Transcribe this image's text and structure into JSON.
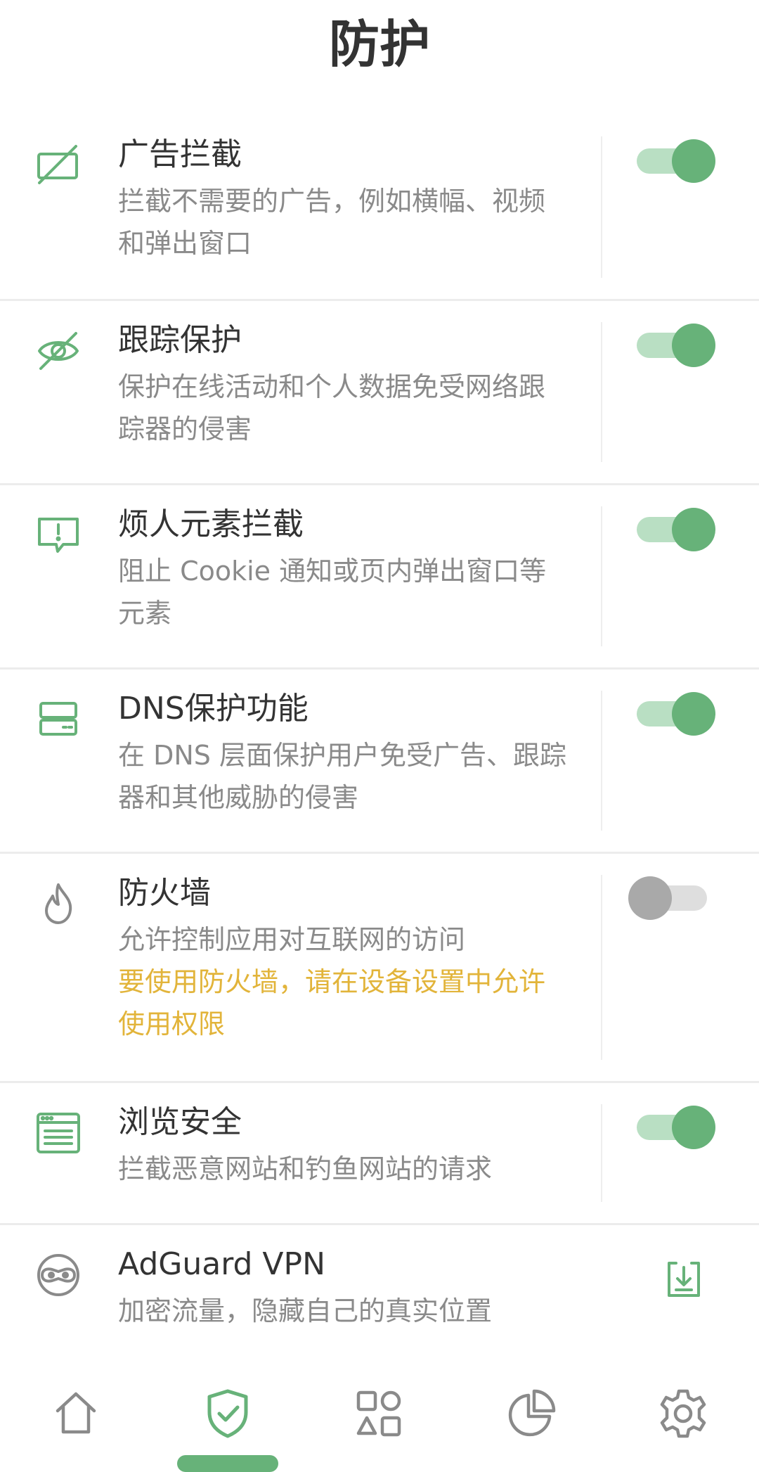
{
  "header": {
    "title": "防护"
  },
  "colors": {
    "accent": "#67b279",
    "accent_light": "#b9dfc3",
    "warning": "#e2b43a",
    "toggle_off": "#a9a9a9"
  },
  "items": [
    {
      "label": "广告拦截",
      "desc": "拦截不需要的广告，例如横幅、视频和弹出窗口",
      "icon": "ad-block-icon",
      "toggle_on": true
    },
    {
      "label": "跟踪保护",
      "desc": "保护在线活动和个人数据免受网络跟踪器的侵害",
      "icon": "eye-off-icon",
      "toggle_on": true
    },
    {
      "label": "烦人元素拦截",
      "desc": "阻止 Cookie 通知或页内弹出窗口等元素",
      "icon": "alert-message-icon",
      "toggle_on": true
    },
    {
      "label": "DNS保护功能",
      "desc": "在 DNS 层面保护用户免受广告、跟踪器和其他威胁的侵害",
      "icon": "dns-server-icon",
      "toggle_on": true
    },
    {
      "label": "防火墙",
      "desc": "允许控制应用对互联网的访问",
      "warning": "要使用防火墙，请在设备设置中允许使用权限",
      "icon": "flame-icon",
      "toggle_on": false
    },
    {
      "label": "浏览安全",
      "desc": "拦截恶意网站和钓鱼网站的请求",
      "icon": "browser-window-icon",
      "toggle_on": true
    },
    {
      "label": "AdGuard VPN",
      "desc": "加密流量，隐藏自己的真实位置",
      "icon": "vpn-mask-icon",
      "action": "download-icon"
    }
  ],
  "bottom_nav": {
    "items": [
      "home-icon",
      "shield-check-icon",
      "apps-grid-icon",
      "pie-chart-icon",
      "gear-icon"
    ],
    "active": "shield-check-icon"
  }
}
